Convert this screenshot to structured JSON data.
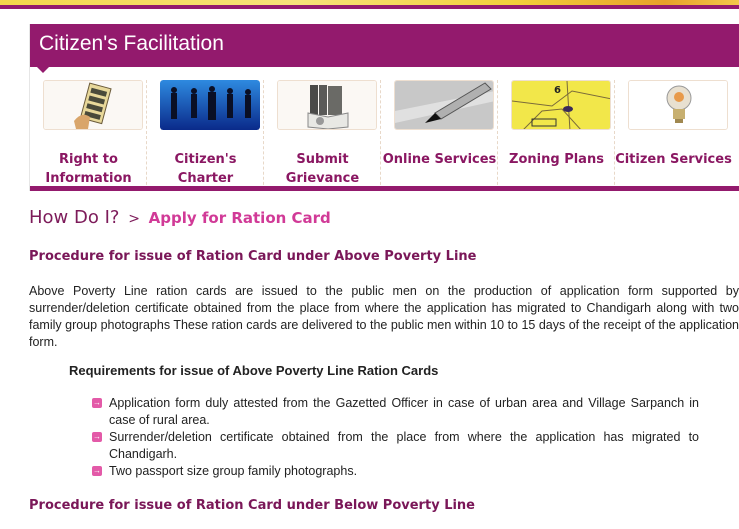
{
  "facilitation": {
    "title": "Citizen's Facilitation",
    "tiles": [
      {
        "label": "Right to Information",
        "icon": "rti-document-hand-icon"
      },
      {
        "label": "Citizen's Charter",
        "icon": "people-silhouettes-icon"
      },
      {
        "label": "Submit Grievance",
        "icon": "books-icon"
      },
      {
        "label": "Online Services",
        "icon": "pen-icon"
      },
      {
        "label": "Zoning Plans",
        "icon": "map-icon"
      },
      {
        "label": "Citizen Services",
        "icon": "lightbulb-icon"
      }
    ]
  },
  "breadcrumb": {
    "root": "How Do I?",
    "separator": ">",
    "current": "Apply for Ration Card"
  },
  "content": {
    "apl_heading": "Procedure for issue of Ration Card under Above Poverty Line",
    "apl_paragraph": "Above Poverty Line ration cards are issued to the public men on the production of application form supported by surrender/deletion certificate obtained from the place from where the application has migrated to Chandigarh along with two family group photographs These ration cards are delivered to the public men within 10 to 15 days of the receipt of the application form.",
    "requirements_heading": "Requirements for issue of Above Poverty Line Ration Cards",
    "requirements": [
      "Application form duly attested from the Gazetted Officer in case of urban area and Village Sarpanch in case of rural area.",
      "Surrender/deletion certificate obtained from the place from where the application has migrated to Chandigarh.",
      "Two passport size group family photographs."
    ],
    "bpl_heading": "Procedure for issue of Ration Card under Below Poverty Line"
  },
  "colors": {
    "brand": "#931a6d",
    "accent_pink": "#d13a97",
    "bullet": "#e35aa8"
  }
}
